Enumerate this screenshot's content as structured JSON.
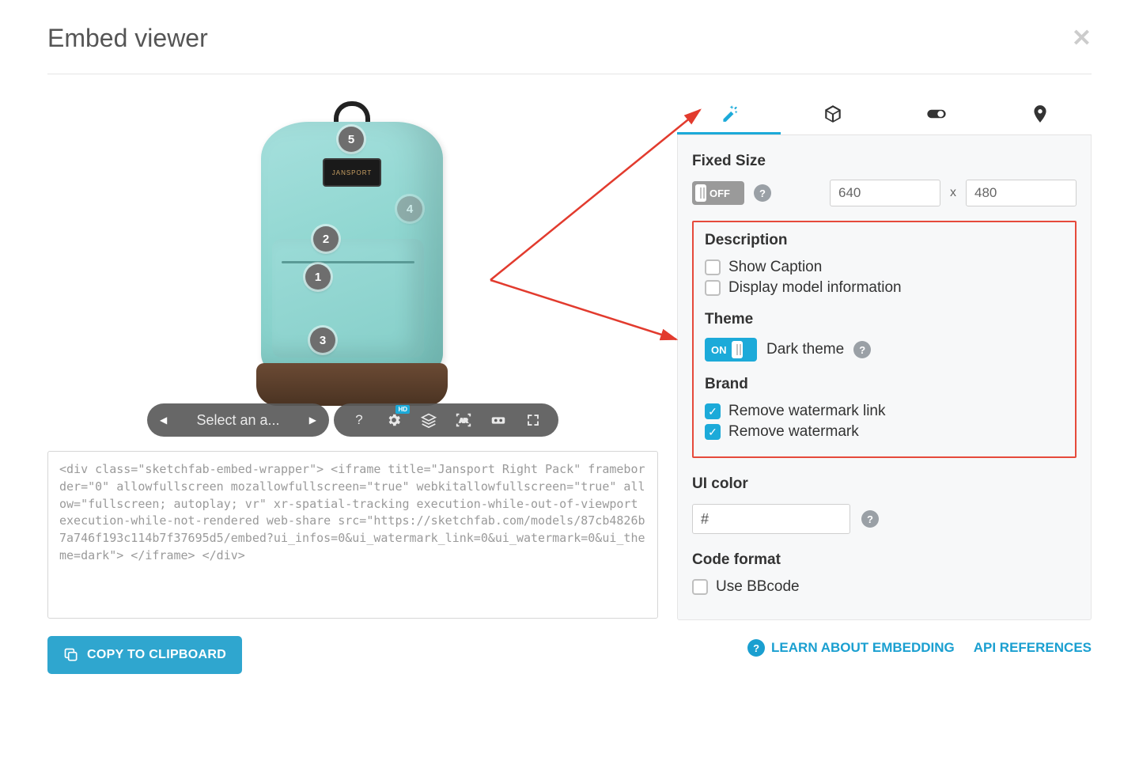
{
  "header": {
    "title": "Embed viewer"
  },
  "viewer": {
    "product_patch_text": "JANSPORT",
    "hotspots": [
      "1",
      "2",
      "3",
      "4",
      "5"
    ],
    "select_placeholder": "Select an a...",
    "settings_badge": "HD"
  },
  "code": {
    "snippet": "<div class=\"sketchfab-embed-wrapper\"> <iframe title=\"Jansport Right Pack\" frameborder=\"0\" allowfullscreen mozallowfullscreen=\"true\" webkitallowfullscreen=\"true\" allow=\"fullscreen; autoplay; vr\" xr-spatial-tracking execution-while-out-of-viewport execution-while-not-rendered web-share src=\"https://sketchfab.com/models/87cb4826b7a746f193c114b7f37695d5/embed?ui_infos=0&ui_watermark_link=0&ui_watermark=0&ui_theme=dark\"> </iframe> </div>"
  },
  "actions": {
    "copy_label": "COPY TO CLIPBOARD"
  },
  "panel": {
    "fixed_size": {
      "title": "Fixed Size",
      "state": "OFF",
      "width": "640",
      "height": "480",
      "sep": "x"
    },
    "description": {
      "title": "Description",
      "show_caption_label": "Show Caption",
      "display_model_info_label": "Display model information",
      "show_caption_checked": false,
      "display_model_info_checked": false
    },
    "theme": {
      "title": "Theme",
      "state": "ON",
      "label": "Dark theme"
    },
    "brand": {
      "title": "Brand",
      "remove_watermark_link_label": "Remove watermark link",
      "remove_watermark_label": "Remove watermark",
      "remove_watermark_link_checked": true,
      "remove_watermark_checked": true
    },
    "ui_color": {
      "title": "UI color",
      "value": "#"
    },
    "code_format": {
      "title": "Code format",
      "use_bbcode_label": "Use BBcode",
      "use_bbcode_checked": false
    }
  },
  "footer": {
    "learn_label": "LEARN ABOUT EMBEDDING",
    "api_label": "API REFERENCES"
  }
}
